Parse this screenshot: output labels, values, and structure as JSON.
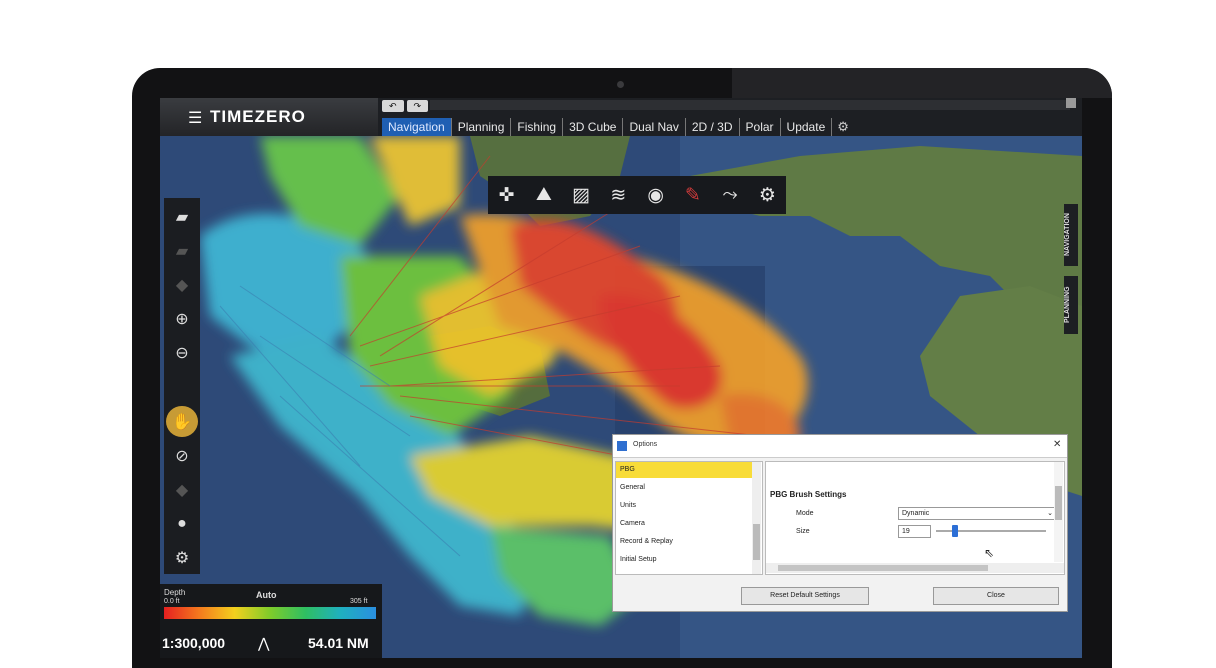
{
  "app": {
    "title": "TIMEZERO",
    "menu_icon": "hamburger-icon"
  },
  "undo_redo": [
    "↶",
    "↷"
  ],
  "tabs": [
    {
      "label": "Navigation",
      "active": true
    },
    {
      "label": "Planning"
    },
    {
      "label": "Fishing"
    },
    {
      "label": "3D Cube"
    },
    {
      "label": "Dual Nav"
    },
    {
      "label": "2D / 3D"
    },
    {
      "label": "Polar"
    },
    {
      "label": "Update"
    }
  ],
  "toolbar": {
    "icons": [
      "compass-icon",
      "route-icon",
      "chart-icon",
      "layers-icon",
      "target-icon",
      "brush-icon",
      "path-icon",
      "settings-icon"
    ]
  },
  "side_tabs": [
    "NAVIGATION",
    "PLANNING"
  ],
  "scale_panel": {
    "depth_label": "Depth",
    "mode": "Auto",
    "min": "0.0 ft",
    "max": "305 ft",
    "scale": "1:300,000",
    "distance": "54.01 NM"
  },
  "options": {
    "title": "Options",
    "categories": [
      "PBG",
      "General",
      "Units",
      "Camera",
      "Record & Replay",
      "Initial Setup"
    ],
    "selected_category": "PBG",
    "section_title": "PBG Brush Settings",
    "mode_label": "Mode",
    "mode_value": "Dynamic",
    "size_label": "Size",
    "size_value": "19",
    "size_fraction": 0.15,
    "reset_button": "Reset Default Settings",
    "close_button": "Close"
  },
  "colors": {
    "accent": "#1f5fb3",
    "selected": "#f8dc38"
  }
}
